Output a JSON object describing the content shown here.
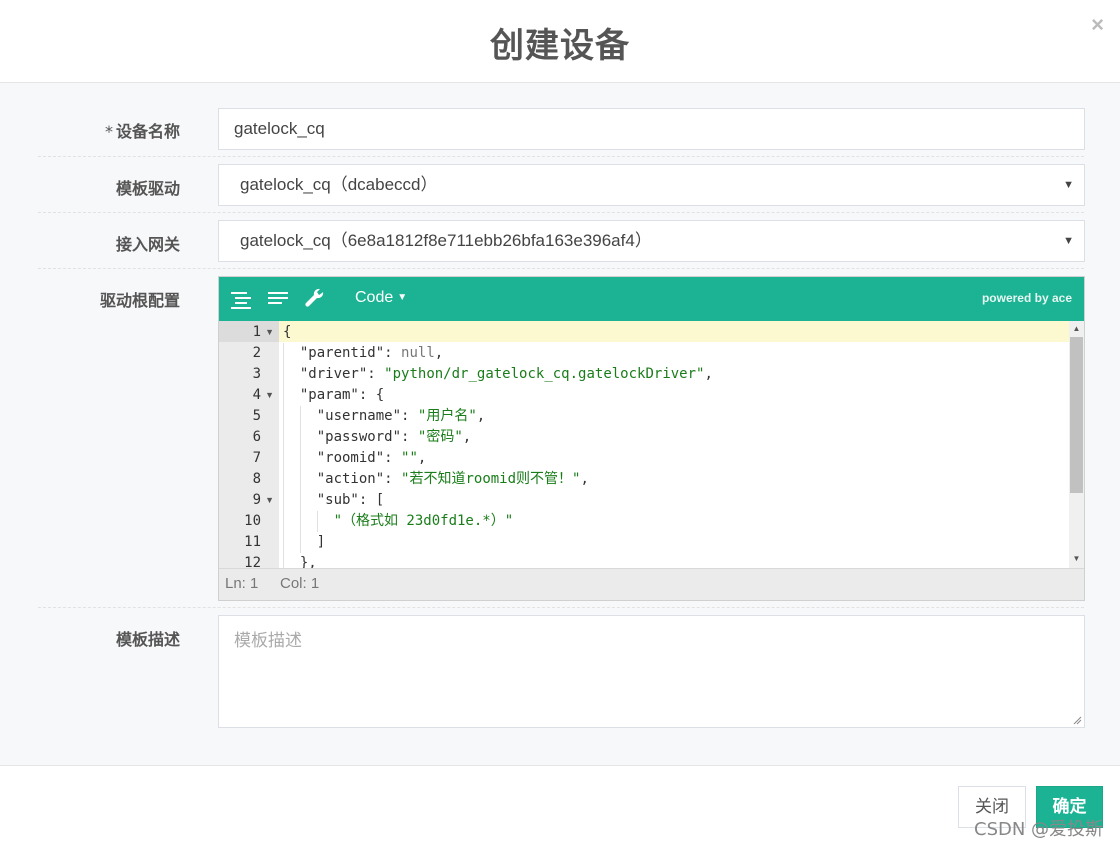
{
  "dialog": {
    "title": "创建设备",
    "close_glyph": "×"
  },
  "form": {
    "device_name": {
      "required_mark": "*",
      "label": "设备名称",
      "value": "gatelock_cq"
    },
    "template_driver": {
      "label": "模板驱动",
      "value": "gatelock_cq（dcabeccd）"
    },
    "gateway": {
      "label": "接入网关",
      "value": "gatelock_cq（6e8a1812f8e711ebb26bfa163e396af4）"
    },
    "driver_config": {
      "label": "驱动根配置"
    },
    "template_desc": {
      "label": "模板描述",
      "placeholder": "模板描述"
    }
  },
  "editor": {
    "mode_label": "Code",
    "powered_by": "powered by ace",
    "status": {
      "ln": "Ln: 1",
      "col": "Col: 1"
    },
    "line_numbers": [
      "1",
      "2",
      "3",
      "4",
      "5",
      "6",
      "7",
      "8",
      "9",
      "10",
      "11",
      "12"
    ],
    "fold_lines": [
      "1",
      "4",
      "9"
    ],
    "lines": [
      "{",
      "  \"parentid\": null,",
      "  \"driver\": \"python/dr_gatelock_cq.gatelockDriver\",",
      "  \"param\": {",
      "    \"username\": \"用户名\",",
      "    \"password\": \"密码\",",
      "    \"roomid\": \"\",",
      "    \"action\": \"若不知道roomid则不管！\",",
      "    \"sub\": [",
      "      \"（格式如 23d0fd1e.*）\"",
      "    ]",
      "  },"
    ]
  },
  "footer": {
    "close_label": "关闭",
    "ok_label": "确定"
  },
  "watermark": "CSDN @爱投斯",
  "colors": {
    "accent": "#1bb394",
    "string": "#1a7d1a",
    "active_line": "#fcf9d0"
  }
}
